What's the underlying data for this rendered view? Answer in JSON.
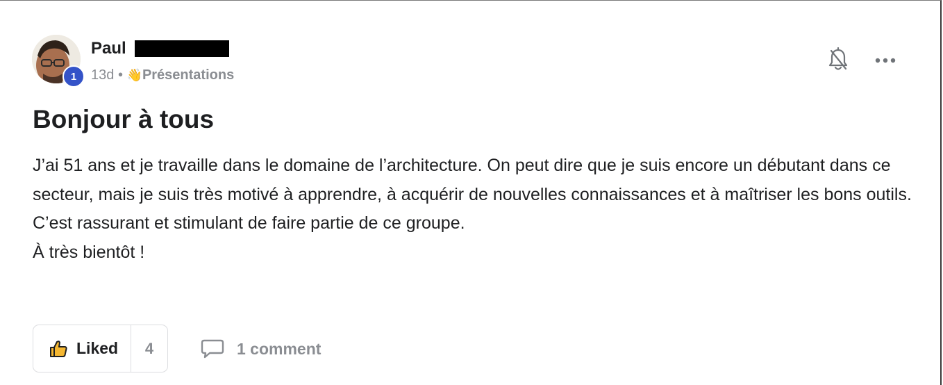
{
  "post": {
    "author": {
      "name": "Paul",
      "level": "1"
    },
    "meta": {
      "age": "13d",
      "separator": "•",
      "category_emoji": "👋",
      "category": "Présentations"
    },
    "title": "Bonjour à tous",
    "body": [
      "J’ai 51 ans et je travaille dans le domaine de l’architecture. On peut dire que je suis encore un débutant dans ce secteur, mais je suis très motivé à apprendre, à acquérir de nouvelles connaissances et à maîtriser les bons outils.",
      "C’est rassurant et stimulant de faire partie de ce groupe.",
      "À très bientôt !"
    ],
    "actions": {
      "like_label": "Liked",
      "like_count": "4",
      "comment_label": "1 comment"
    }
  },
  "icons": {
    "notification": "bell-slash-icon",
    "more": "more-horizontal-icon",
    "like": "thumbs-up-icon",
    "comment": "comment-bubble-icon"
  },
  "colors": {
    "level_badge": "#3453c8",
    "muted_text": "#8a8d92",
    "primary_text": "#1e1f21",
    "button_border": "#dcdde0",
    "like_icon_fill": "#f5b731"
  }
}
